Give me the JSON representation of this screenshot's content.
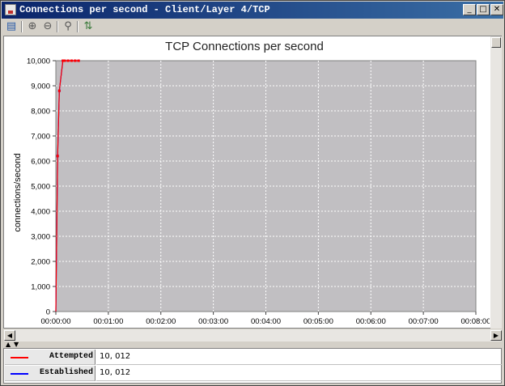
{
  "window": {
    "title": "Connections per second - Client/Layer 4/TCP",
    "controls": [
      "_",
      "□",
      "✕"
    ]
  },
  "toolbar": {
    "icons": [
      "save-icon",
      "zoom-in-icon",
      "zoom-out-icon",
      "zoom-reset-icon",
      "sort-icon"
    ]
  },
  "chart_data": {
    "type": "line",
    "title": "TCP Connections per second",
    "ylabel": "connections/second",
    "xlabel": "",
    "ylim": [
      0,
      10000
    ],
    "y_ticks": [
      "0",
      "1,000",
      "2,000",
      "3,000",
      "4,000",
      "5,000",
      "6,000",
      "7,000",
      "8,000",
      "9,000",
      "10,000"
    ],
    "x_ticks": [
      "00:00:00",
      "00:01:00",
      "00:02:00",
      "00:03:00",
      "00:04:00",
      "00:05:00",
      "00:06:00",
      "00:07:00",
      "00:08:00"
    ],
    "xlim_seconds": [
      0,
      480
    ],
    "plot_background": "#c1bfc2",
    "grid": true,
    "series": [
      {
        "name": "Attempted",
        "color": "#ff0000",
        "x_seconds": [
          0,
          2,
          4,
          8,
          10,
          14,
          18,
          22,
          26
        ],
        "values": [
          0,
          6200,
          8800,
          10000,
          10000,
          10000,
          10000,
          10000,
          10000
        ]
      },
      {
        "name": "Established",
        "color": "#0000ff",
        "x_seconds": [
          0,
          2,
          4,
          8,
          10,
          14,
          18,
          22,
          26
        ],
        "values": [
          0,
          6200,
          8800,
          10000,
          10000,
          10000,
          10000,
          10000,
          10000
        ]
      }
    ]
  },
  "legend": [
    {
      "name": "Attempted",
      "color": "#ff0000",
      "value": "10, 012"
    },
    {
      "name": "Established",
      "color": "#0000ff",
      "value": "10, 012"
    }
  ]
}
